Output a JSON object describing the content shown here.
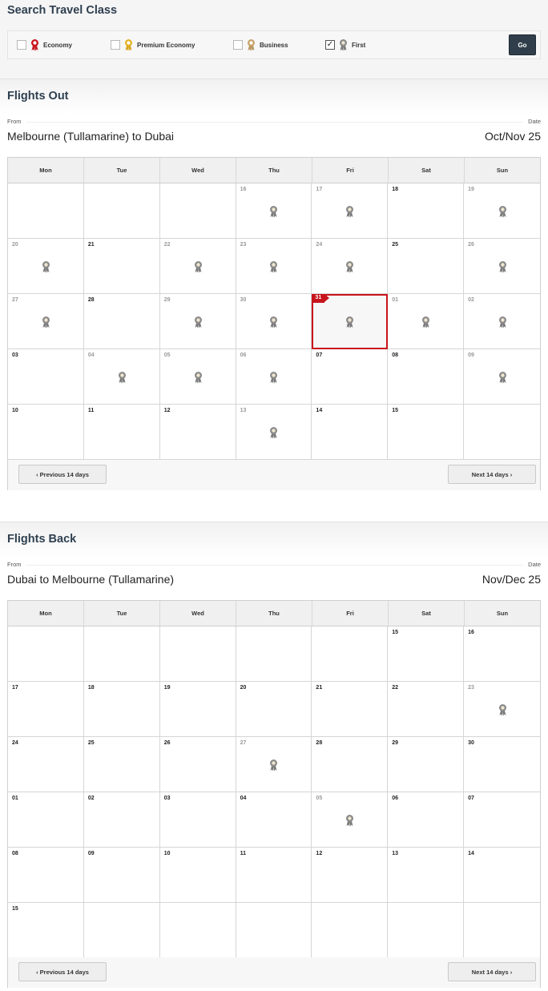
{
  "travel_class": {
    "title": "Search Travel Class",
    "options": [
      {
        "label": "Economy",
        "checked": false,
        "medal": "red-ribbon-medal-icon"
      },
      {
        "label": "Premium Economy",
        "checked": false,
        "medal": "gold-medal-icon"
      },
      {
        "label": "Business",
        "checked": false,
        "medal": "bronze-medal-icon"
      },
      {
        "label": "First",
        "checked": true,
        "medal": "grey-medal-icon"
      }
    ],
    "go_label": "Go"
  },
  "weekdays": [
    "Mon",
    "Tue",
    "Wed",
    "Thu",
    "Fri",
    "Sat",
    "Sun"
  ],
  "flights_out": {
    "title": "Flights Out",
    "from_label": "From",
    "date_label": "Date",
    "route": "Melbourne (Tullamarine) to Dubai",
    "period": "Oct/Nov 25",
    "prev_label": "‹ Previous 14 days",
    "next_label": "Next 14 days ›",
    "selected": "31",
    "rows": [
      [
        {
          "d": "",
          "a": false
        },
        {
          "d": "",
          "a": false
        },
        {
          "d": "",
          "a": false
        },
        {
          "d": "16",
          "a": true
        },
        {
          "d": "17",
          "a": true
        },
        {
          "d": "18",
          "a": false
        },
        {
          "d": "19",
          "a": true
        }
      ],
      [
        {
          "d": "20",
          "a": true
        },
        {
          "d": "21",
          "a": false
        },
        {
          "d": "22",
          "a": true
        },
        {
          "d": "23",
          "a": true
        },
        {
          "d": "24",
          "a": true
        },
        {
          "d": "25",
          "a": false
        },
        {
          "d": "26",
          "a": true
        }
      ],
      [
        {
          "d": "27",
          "a": true
        },
        {
          "d": "28",
          "a": false
        },
        {
          "d": "29",
          "a": true
        },
        {
          "d": "30",
          "a": true
        },
        {
          "d": "31",
          "a": true
        },
        {
          "d": "01",
          "a": true
        },
        {
          "d": "02",
          "a": true
        }
      ],
      [
        {
          "d": "03",
          "a": false
        },
        {
          "d": "04",
          "a": true
        },
        {
          "d": "05",
          "a": true
        },
        {
          "d": "06",
          "a": true
        },
        {
          "d": "07",
          "a": false
        },
        {
          "d": "08",
          "a": false
        },
        {
          "d": "09",
          "a": true
        }
      ],
      [
        {
          "d": "10",
          "a": false
        },
        {
          "d": "11",
          "a": false
        },
        {
          "d": "12",
          "a": false
        },
        {
          "d": "13",
          "a": true
        },
        {
          "d": "14",
          "a": false
        },
        {
          "d": "15",
          "a": false
        },
        {
          "d": "",
          "a": false
        }
      ]
    ]
  },
  "flights_back": {
    "title": "Flights Back",
    "from_label": "From",
    "date_label": "Date",
    "route": "Dubai to Melbourne (Tullamarine)",
    "period": "Nov/Dec 25",
    "prev_label": "‹ Previous 14 days",
    "next_label": "Next 14 days ›",
    "selected": "",
    "rows": [
      [
        {
          "d": "",
          "a": false
        },
        {
          "d": "",
          "a": false
        },
        {
          "d": "",
          "a": false
        },
        {
          "d": "",
          "a": false
        },
        {
          "d": "",
          "a": false
        },
        {
          "d": "15",
          "a": false
        },
        {
          "d": "16",
          "a": false
        }
      ],
      [
        {
          "d": "17",
          "a": false
        },
        {
          "d": "18",
          "a": false
        },
        {
          "d": "19",
          "a": false
        },
        {
          "d": "20",
          "a": false
        },
        {
          "d": "21",
          "a": false
        },
        {
          "d": "22",
          "a": false
        },
        {
          "d": "23",
          "a": true
        }
      ],
      [
        {
          "d": "24",
          "a": false
        },
        {
          "d": "25",
          "a": false
        },
        {
          "d": "26",
          "a": false
        },
        {
          "d": "27",
          "a": true
        },
        {
          "d": "28",
          "a": false
        },
        {
          "d": "29",
          "a": false
        },
        {
          "d": "30",
          "a": false
        }
      ],
      [
        {
          "d": "01",
          "a": false
        },
        {
          "d": "02",
          "a": false
        },
        {
          "d": "03",
          "a": false
        },
        {
          "d": "04",
          "a": false
        },
        {
          "d": "05",
          "a": true
        },
        {
          "d": "06",
          "a": false
        },
        {
          "d": "07",
          "a": false
        }
      ],
      [
        {
          "d": "08",
          "a": false
        },
        {
          "d": "09",
          "a": false
        },
        {
          "d": "10",
          "a": false
        },
        {
          "d": "11",
          "a": false
        },
        {
          "d": "12",
          "a": false
        },
        {
          "d": "13",
          "a": false
        },
        {
          "d": "14",
          "a": false
        }
      ],
      [
        {
          "d": "15",
          "a": false
        },
        {
          "d": "",
          "a": false
        },
        {
          "d": "",
          "a": false
        },
        {
          "d": "",
          "a": false
        },
        {
          "d": "",
          "a": false
        },
        {
          "d": "",
          "a": false
        },
        {
          "d": "",
          "a": false
        }
      ]
    ]
  },
  "colors": {
    "accent_red": "#c8141c",
    "navy": "#2f3e4a",
    "heading": "#2f4050",
    "medal_grey": "#8a8a8a",
    "medal_gold": "#e3b325",
    "medal_bronze": "#c7a36a",
    "medal_red": "#c8141c"
  }
}
